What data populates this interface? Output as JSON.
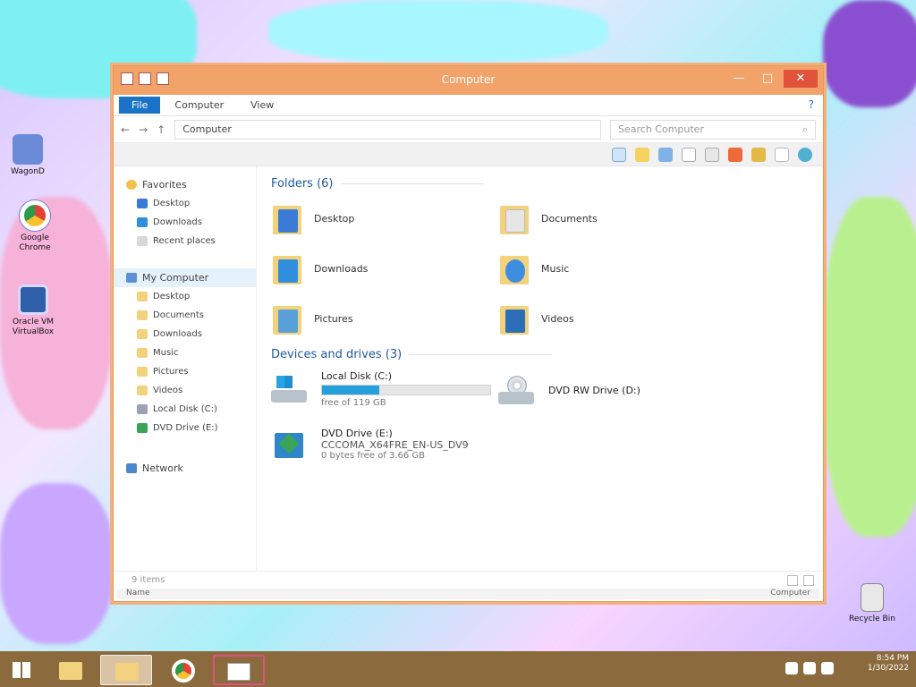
{
  "desktop": {
    "icons": [
      {
        "label": "WagonD",
        "icon": "app-icon"
      },
      {
        "label": "Google Chrome",
        "icon": "chrome-icon"
      },
      {
        "label": "Oracle VM VirtualBox",
        "icon": "virtualbox-icon"
      },
      {
        "label": "Recycle Bin",
        "icon": "recycle-bin-icon"
      }
    ]
  },
  "window": {
    "title": "Computer",
    "controls": {
      "minimize": "—",
      "maximize": "□",
      "close": "✕"
    },
    "ribbon_tabs": [
      "File",
      "Computer",
      "View"
    ],
    "help": "?",
    "address": {
      "back": "←",
      "forward": "→",
      "up": "↑",
      "path": "Computer"
    },
    "search": {
      "placeholder": "Search Computer",
      "icon": "search-icon"
    },
    "nav_pane": {
      "favorites_header": "Favorites",
      "favorites": [
        "Desktop",
        "Downloads",
        "Recent places"
      ],
      "computer_header": "My Computer",
      "computer_items": [
        "Desktop",
        "Documents",
        "Downloads",
        "Music",
        "Pictures",
        "Videos",
        "Local Disk (C:)",
        "DVD Drive (E:)"
      ],
      "network": "Network"
    },
    "folders_group": {
      "title": "Folders (6)",
      "items": [
        {
          "name": "Desktop",
          "accent": "#3a7bd5"
        },
        {
          "name": "Documents",
          "accent": "#e6e6e6"
        },
        {
          "name": "Downloads",
          "accent": "#2f8fdc"
        },
        {
          "name": "Music",
          "accent": "#3d8ee0"
        },
        {
          "name": "Pictures",
          "accent": "#5aa0d8"
        },
        {
          "name": "Videos",
          "accent": "#2c6fb8"
        }
      ]
    },
    "drives_group": {
      "title": "Devices and drives (3)",
      "drives": [
        {
          "name": "Local Disk (C:)",
          "free": "free of 119 GB",
          "fill_pct": 34
        },
        {
          "name": "DVD RW Drive (D:)"
        },
        {
          "name": "DVD Drive (E:)",
          "label": "CCCOMA_X64FRE_EN-US_DV9",
          "free": "0 bytes free of 3.66 GB"
        }
      ]
    },
    "status": {
      "items": "9 items",
      "left": "Name",
      "right": "Computer"
    }
  },
  "taskbar": {
    "clock_time": "8:54 PM",
    "clock_date": "1/30/2022",
    "tray_icons": [
      "flag-icon",
      "network-icon",
      "volume-icon"
    ]
  }
}
